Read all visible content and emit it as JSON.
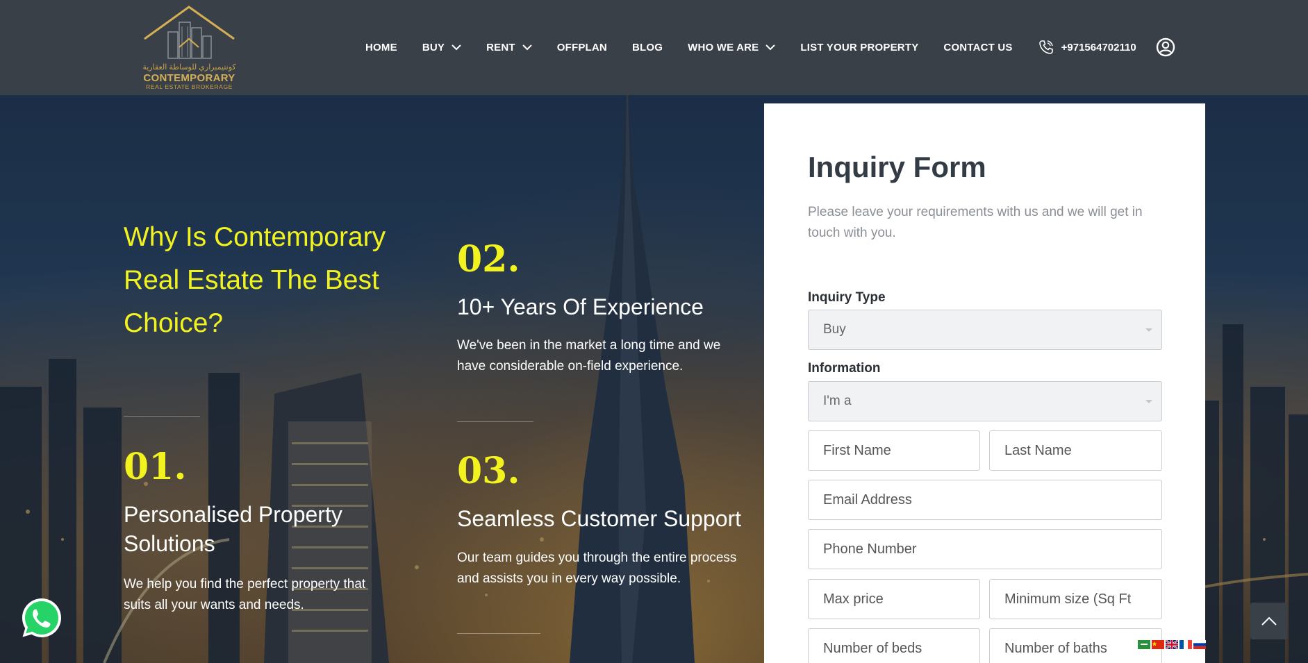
{
  "logo": {
    "arabic": "كونتيمبراري للوساطة العقارية",
    "name": "CONTEMPORARY",
    "tagline": "REAL ESTATE BROKERAGE"
  },
  "nav": {
    "home": "HOME",
    "buy": "BUY",
    "rent": "RENT",
    "offplan": "OFFPLAN",
    "blog": "BLOG",
    "who_we_are": "WHO WE ARE",
    "list_property": "LIST YOUR PROPERTY",
    "contact": "CONTACT US",
    "phone": "+971564702110"
  },
  "hero": {
    "why_title": "Why Is Contemporary Real Estate The Best Choice?",
    "features": [
      {
        "number": "01.",
        "title": "Personalised Property Solutions",
        "description": "We help you find the perfect property that suits all your wants and needs."
      },
      {
        "number": "02.",
        "title": "10+ Years Of Experience",
        "description": "We've been in the market a long time and we have considerable on-field experience."
      },
      {
        "number": "03.",
        "title": "Seamless Customer Support",
        "description": "Our team guides you through the entire process and assists you in every way possible."
      }
    ]
  },
  "form": {
    "title": "Inquiry Form",
    "subtitle": "Please leave your requirements with us and we will get in touch with you.",
    "inquiry_type_label": "Inquiry Type",
    "inquiry_type_value": "Buy",
    "information_label": "Information",
    "information_value": "I'm a",
    "first_name_placeholder": "First Name",
    "last_name_placeholder": "Last Name",
    "email_placeholder": "Email Address",
    "phone_placeholder": "Phone Number",
    "max_price_placeholder": "Max price",
    "min_size_placeholder": "Minimum size (Sq Ft",
    "beds_placeholder": "Number of beds",
    "baths_placeholder": "Number of baths"
  },
  "colors": {
    "header_bg": "#3a4048",
    "accent_yellow": "#f2f21e",
    "gold": "#d4af55",
    "whatsapp_green": "#25d366"
  },
  "icons": {
    "phone": "phone-icon",
    "user": "user-circle-icon",
    "whatsapp": "whatsapp-icon",
    "scroll_top": "chevron-up-icon"
  },
  "languages": [
    "Arabic",
    "Chinese",
    "English",
    "French",
    "Russian"
  ]
}
